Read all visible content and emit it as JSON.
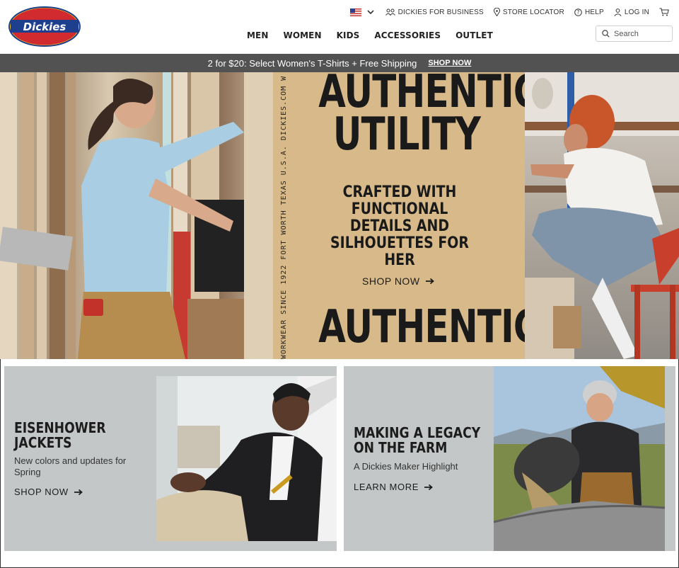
{
  "header": {
    "logo_text": "Dickies",
    "utility": {
      "country_flag": "us-flag-icon",
      "business": "DICKIES FOR BUSINESS",
      "store_locator": "STORE LOCATOR",
      "help": "HELP",
      "login": "LOG IN"
    },
    "nav": [
      "MEN",
      "WOMEN",
      "KIDS",
      "ACCESSORIES",
      "OUTLET"
    ],
    "search_placeholder": "Search"
  },
  "promo": {
    "text": "2 for $20: Select Women's T-Shirts + Free Shipping",
    "cta": "SHOP NOW"
  },
  "hero": {
    "headline_line1": "AUTHENTIC",
    "headline_line2": "UTILITY",
    "subhead": "CRAFTED WITH FUNCTIONAL DETAILS AND SILHOUETTES FOR HER",
    "cta": "SHOP NOW",
    "repeat_line1": "AUTHENTIC",
    "vertical_text": "WORKWEAR SINCE 1922  FORT WORTH TEXAS U.S.A.  DICKIES.COM  W"
  },
  "cards": [
    {
      "title_line1": "EISENHOWER",
      "title_line2": "JACKETS",
      "subtitle_line1": "New colors and updates for",
      "subtitle_line2": "Spring",
      "cta": "SHOP NOW"
    },
    {
      "title_line1": "MAKING A LEGACY",
      "title_line2": "ON THE FARM",
      "subtitle_line1": "A Dickies Maker Highlight",
      "cta": "LEARN MORE"
    }
  ],
  "colors": {
    "promo_bg": "#525252",
    "hero_panel": "#d8ba8a",
    "card_bg": "#c4c7c7",
    "logo_red": "#d12a2f",
    "logo_yellow": "#f6c31a",
    "logo_blue": "#1e3f8e"
  }
}
